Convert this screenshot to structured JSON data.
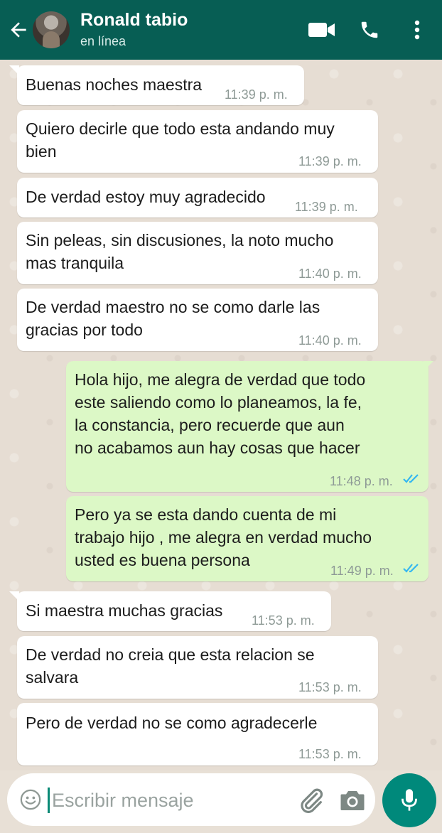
{
  "header": {
    "contact_name": "Ronald tabio",
    "status": "en línea",
    "background_color": "#075e54"
  },
  "messages": [
    {
      "direction": "in",
      "lines": [
        "Buenas noches maestra"
      ],
      "time": "11:39 p. m."
    },
    {
      "direction": "in",
      "lines": [
        "Quiero decirle que todo esta andando muy",
        "bien"
      ],
      "time": "11:39 p. m."
    },
    {
      "direction": "in",
      "lines": [
        "De verdad estoy muy agradecido"
      ],
      "time": "11:39 p. m."
    },
    {
      "direction": "in",
      "lines": [
        "Sin peleas, sin discusiones, la noto mucho",
        "mas tranquila"
      ],
      "time": "11:40 p. m."
    },
    {
      "direction": "in",
      "lines": [
        "De verdad maestro no se como darle las",
        "gracias por todo"
      ],
      "time": "11:40 p. m."
    },
    {
      "direction": "out",
      "lines": [
        "Hola hijo, me alegra de verdad que todo",
        "este saliendo como lo planeamos, la fe,",
        "la constancia, pero recuerde que aun",
        "no acabamos aun hay cosas que hacer"
      ],
      "time": "11:48 p. m.",
      "read": true
    },
    {
      "direction": "out",
      "lines": [
        "Pero ya se esta dando cuenta de mi",
        "trabajo hijo , me alegra en verdad mucho",
        "usted es buena persona"
      ],
      "time": "11:49 p. m.",
      "read": true
    },
    {
      "direction": "in",
      "lines": [
        "Si maestra muchas gracias"
      ],
      "time": "11:53 p. m."
    },
    {
      "direction": "in",
      "lines": [
        "De verdad no creia que esta relacion se",
        "salvara"
      ],
      "time": "11:53 p. m."
    },
    {
      "direction": "in",
      "lines": [
        "Pero de verdad no se como agradecerle"
      ],
      "time": "11:53 p. m."
    }
  ],
  "composer": {
    "placeholder": "Escribir mensaje"
  },
  "colors": {
    "incoming_bubble": "#ffffff",
    "outgoing_bubble": "#dcf8c6",
    "read_ticks": "#34b7f1",
    "accent": "#00897b"
  },
  "icons": {
    "back": "arrow-left-icon",
    "video": "video-camera-icon",
    "call": "phone-icon",
    "menu": "more-vertical-icon",
    "emoji": "smiley-icon",
    "attach": "paperclip-icon",
    "camera": "camera-icon",
    "mic": "microphone-icon"
  }
}
